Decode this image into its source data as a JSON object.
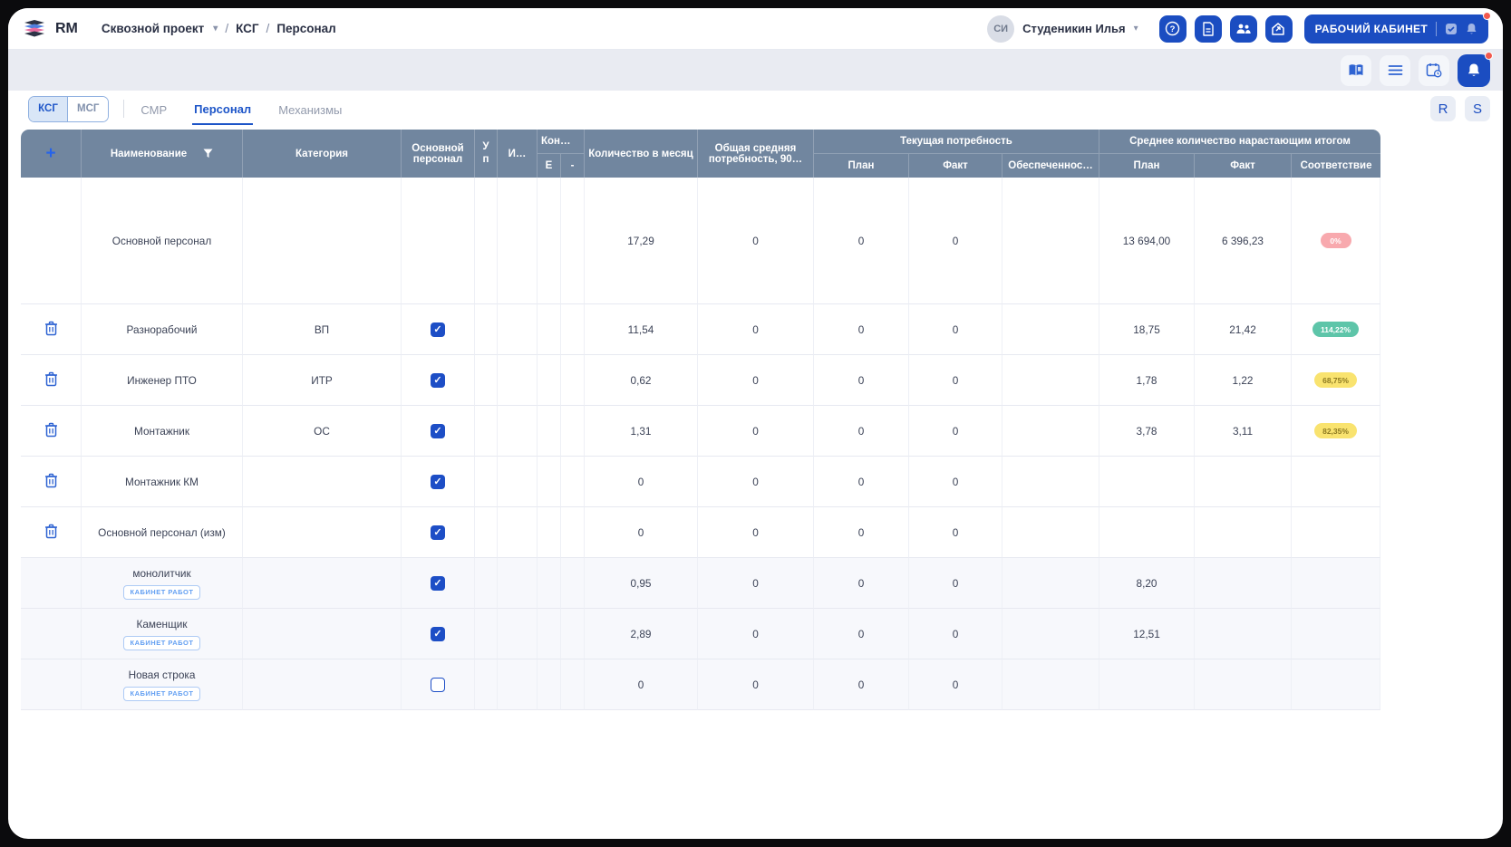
{
  "topbar": {
    "logo_text": "RM",
    "breadcrumb": {
      "project": "Сквозной проект",
      "sep1": "/",
      "level1": "КСГ",
      "sep2": "/",
      "level2": "Персонал"
    },
    "user": {
      "initials": "СИ",
      "name": "Студеникин Илья"
    },
    "help_glyph": "?",
    "workspace_button": "РАБОЧИЙ КАБИНЕТ"
  },
  "tabrow": {
    "segmented": [
      {
        "label": "КСГ",
        "active": true
      },
      {
        "label": "МСГ",
        "active": false
      }
    ],
    "tabs": [
      {
        "label": "СМР",
        "active": false
      },
      {
        "label": "Персонал",
        "active": true
      },
      {
        "label": "Механизмы",
        "active": false
      }
    ],
    "r_button": "R",
    "s_button": "S"
  },
  "table": {
    "columns": {
      "add": "+",
      "name": "Наименование",
      "category": "Категория",
      "main_personnel": "Основной персонал",
      "up": "У\nп",
      "i": "И…",
      "kon": "Кон…",
      "kon_e": "Е",
      "kon_dash": "-",
      "qty_month": "Количество в месяц",
      "total_avg": "Общая средняя потребность, 90…",
      "current_group": "Текущая потребность",
      "cur_plan": "План",
      "cur_fact": "Факт",
      "provision": "Обеспеченнос…",
      "avg_group": "Среднее количество нарастающим итогом",
      "avg_plan": "План",
      "avg_fact": "Факт",
      "match": "Соответствие"
    },
    "rows": [
      {
        "name": "Основной персонал",
        "category": "",
        "checkbox": "none",
        "deletable": false,
        "tall": true,
        "shaded": false,
        "qty": "17,29",
        "total": "0",
        "cur_plan": "0",
        "cur_fact": "0",
        "provision": "",
        "avg_plan": "13 694,00",
        "avg_fact": "6 396,23",
        "badge": {
          "text": "0%",
          "type": "red"
        }
      },
      {
        "name": "Разнорабочий",
        "category": "ВП",
        "checkbox": "checked",
        "deletable": true,
        "shaded": false,
        "qty": "11,54",
        "total": "0",
        "cur_plan": "0",
        "cur_fact": "0",
        "provision": "",
        "avg_plan": "18,75",
        "avg_fact": "21,42",
        "badge": {
          "text": "114,22%",
          "type": "green"
        }
      },
      {
        "name": "Инженер ПТО",
        "category": "ИТР",
        "checkbox": "checked",
        "deletable": true,
        "shaded": false,
        "qty": "0,62",
        "total": "0",
        "cur_plan": "0",
        "cur_fact": "0",
        "provision": "",
        "avg_plan": "1,78",
        "avg_fact": "1,22",
        "badge": {
          "text": "68,75%",
          "type": "yellow"
        }
      },
      {
        "name": "Монтажник",
        "category": "ОС",
        "checkbox": "checked",
        "deletable": true,
        "shaded": false,
        "qty": "1,31",
        "total": "0",
        "cur_plan": "0",
        "cur_fact": "0",
        "provision": "",
        "avg_plan": "3,78",
        "avg_fact": "3,11",
        "badge": {
          "text": "82,35%",
          "type": "yellow"
        }
      },
      {
        "name": "Монтажник КМ",
        "category": "",
        "checkbox": "checked",
        "deletable": true,
        "shaded": false,
        "qty": "0",
        "total": "0",
        "cur_plan": "0",
        "cur_fact": "0",
        "provision": "",
        "avg_plan": "",
        "avg_fact": ""
      },
      {
        "name": "Основной персонал (изм)",
        "category": "",
        "checkbox": "checked",
        "deletable": true,
        "shaded": false,
        "qty": "0",
        "total": "0",
        "cur_plan": "0",
        "cur_fact": "0",
        "provision": "",
        "avg_plan": "",
        "avg_fact": ""
      },
      {
        "name": "монолитчик",
        "chip": "КАБИНЕТ РАБОТ",
        "category": "",
        "checkbox": "checked",
        "deletable": false,
        "shaded": true,
        "qty": "0,95",
        "total": "0",
        "cur_plan": "0",
        "cur_fact": "0",
        "provision": "",
        "avg_plan": "8,20",
        "avg_fact": ""
      },
      {
        "name": "Каменщик",
        "chip": "КАБИНЕТ РАБОТ",
        "category": "",
        "checkbox": "checked",
        "deletable": false,
        "shaded": true,
        "qty": "2,89",
        "total": "0",
        "cur_plan": "0",
        "cur_fact": "0",
        "provision": "",
        "avg_plan": "12,51",
        "avg_fact": ""
      },
      {
        "name": "Новая строка",
        "chip": "КАБИНЕТ РАБОТ",
        "category": "",
        "checkbox": "unchecked",
        "deletable": false,
        "shaded": true,
        "qty": "0",
        "total": "0",
        "cur_plan": "0",
        "cur_fact": "0",
        "provision": "",
        "avg_plan": "",
        "avg_fact": ""
      }
    ]
  },
  "colors": {
    "accent": "#1b4dc1",
    "header_bg": "#71869f",
    "badge_red": "#f8a9ae",
    "badge_green": "#5ec5a9",
    "badge_yellow": "#f9e36f",
    "notification": "#f2594e"
  }
}
